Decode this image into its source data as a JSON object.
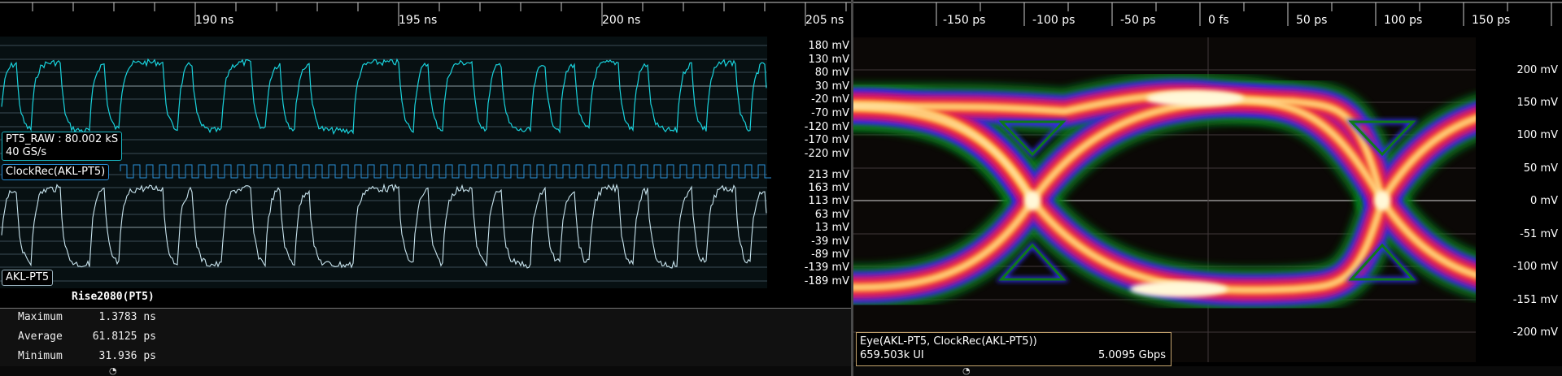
{
  "colors": {
    "raw_trace": "#19d2dc",
    "clock_trace": "#2a8fd8",
    "filtered_trace": "#c8e4ee",
    "grid": "#3b4d55",
    "raw_label_border": "#19b4c0",
    "akl_label_border": "#9bb4c0",
    "eye_label_border": "#c5a46d"
  },
  "waveform_view": {
    "time_ticks": [
      "190 ns",
      "195 ns",
      "200 ns",
      "205 ns"
    ],
    "raw_axis": [
      "180 mV",
      "130 mV",
      "80 mV",
      "30 mV",
      "-20 mV",
      "-70 mV",
      "-120 mV",
      "-170 mV",
      "-220 mV"
    ],
    "filtered_axis": [
      "213 mV",
      "163 mV",
      "113 mV",
      "63 mV",
      "13 mV",
      "-39 mV",
      "-89 mV",
      "-139 mV",
      "-189 mV"
    ],
    "raw_label": {
      "line1": "PT5_RAW : 80.002 kS",
      "line2": "40 GS/s"
    },
    "clock_label": "ClockRec(AKL-PT5)",
    "filtered_label": "AKL-PT5"
  },
  "measurement": {
    "title": "Rise2080(PT5)",
    "rows": [
      {
        "name": "Maximum",
        "value": "1.3783 ns"
      },
      {
        "name": "Average",
        "value": "61.8125 ps"
      },
      {
        "name": "Minimum",
        "value": "31.936 ps"
      }
    ]
  },
  "eye_view": {
    "time_ticks": [
      "-150 ps",
      "-100 ps",
      "-50 ps",
      "0 fs",
      "50 ps",
      "100 ps",
      "150 ps"
    ],
    "volt_axis": [
      "200 mV",
      "150 mV",
      "100 mV",
      "50 mV",
      "0 mV",
      "-51 mV",
      "-100 mV",
      "-151 mV",
      "-200 mV"
    ],
    "label": {
      "line1": "Eye(AKL-PT5, ClockRec(AKL-PT5))",
      "line2": "659.503k UI",
      "rate": "5.0095 Gbps"
    }
  }
}
